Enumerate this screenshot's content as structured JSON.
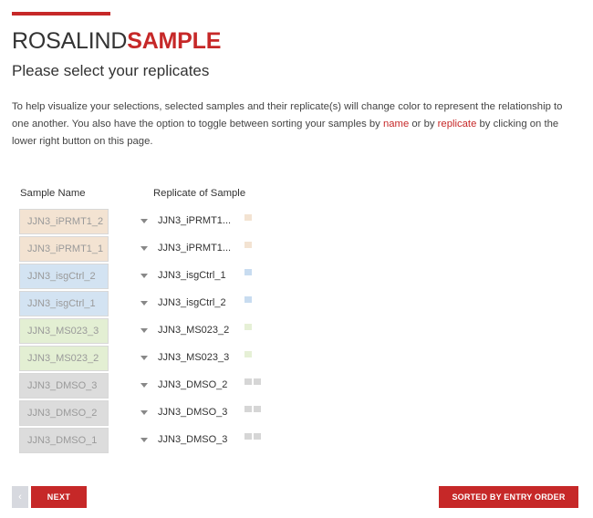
{
  "brand": {
    "part1": "ROSALIND",
    "part2": "SAMPLE"
  },
  "subtitle": "Please select your replicates",
  "intro": {
    "text1": "To help visualize your selections, selected samples and their replicate(s) will change color to represent the relationship to one another. You also have the option to toggle between sorting your samples by ",
    "link_name": "name",
    "text2": " or by ",
    "link_replicate": "replicate",
    "text3": " by clicking on the lower right button on this page."
  },
  "table": {
    "col_sample": "Sample Name",
    "col_replicate": "Replicate of Sample",
    "rows": [
      {
        "sample": "JJN3_iPRMT1_2",
        "replicate": "JJN3_iPRMT1...",
        "bg": "#f3e3d2",
        "swatch": "#f3e3d2",
        "swatch2": ""
      },
      {
        "sample": "JJN3_iPRMT1_1",
        "replicate": "JJN3_iPRMT1...",
        "bg": "#f3e3d2",
        "swatch": "#f3e3d2",
        "swatch2": ""
      },
      {
        "sample": "JJN3_isgCtrl_2",
        "replicate": "JJN3_isgCtrl_1",
        "bg": "#d3e3f2",
        "swatch": "#c8dcf0",
        "swatch2": ""
      },
      {
        "sample": "JJN3_isgCtrl_1",
        "replicate": "JJN3_isgCtrl_2",
        "bg": "#d3e3f2",
        "swatch": "#c8dcf0",
        "swatch2": ""
      },
      {
        "sample": "JJN3_MS023_3",
        "replicate": "JJN3_MS023_2",
        "bg": "#e3efd3",
        "swatch": "#e6f0d6",
        "swatch2": ""
      },
      {
        "sample": "JJN3_MS023_2",
        "replicate": "JJN3_MS023_3",
        "bg": "#e3efd3",
        "swatch": "#e6f0d6",
        "swatch2": ""
      },
      {
        "sample": "JJN3_DMSO_3",
        "replicate": "JJN3_DMSO_2",
        "bg": "#dcdcdc",
        "swatch": "#d6d6d6",
        "swatch2": "#d6d6d6"
      },
      {
        "sample": "JJN3_DMSO_2",
        "replicate": "JJN3_DMSO_3",
        "bg": "#dcdcdc",
        "swatch": "#d6d6d6",
        "swatch2": "#d6d6d6"
      },
      {
        "sample": "JJN3_DMSO_1",
        "replicate": "JJN3_DMSO_3",
        "bg": "#dcdcdc",
        "swatch": "#d6d6d6",
        "swatch2": "#d6d6d6"
      }
    ]
  },
  "buttons": {
    "prev": "‹",
    "next": "NEXT",
    "sort": "SORTED BY ENTRY ORDER"
  },
  "colors": {
    "accent": "#c62828"
  }
}
